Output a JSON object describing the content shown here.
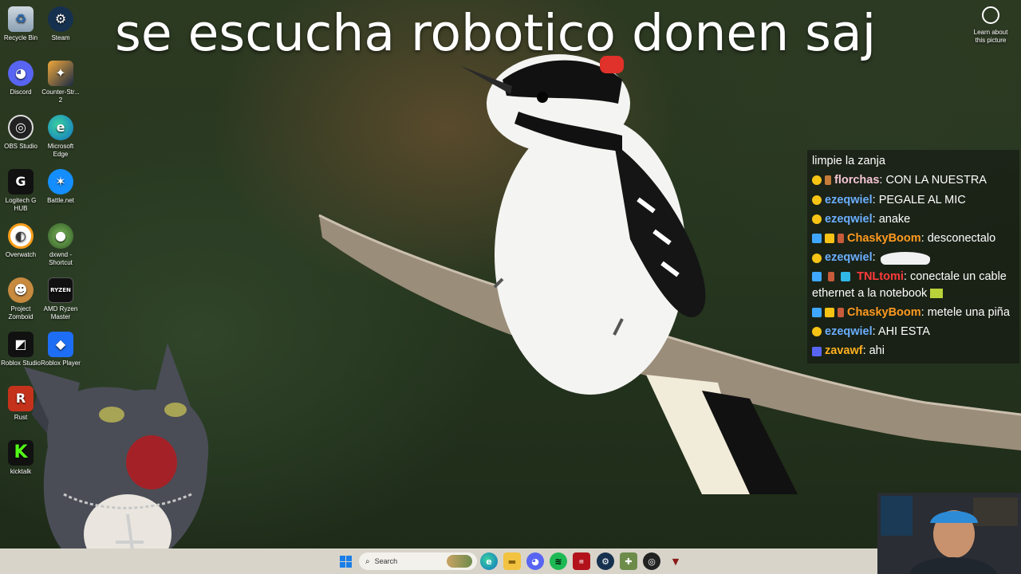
{
  "desktop": {
    "icons": [
      {
        "label": "Recycle Bin",
        "icon": "recycle-bin-icon"
      },
      {
        "label": "Steam",
        "icon": "steam-icon"
      },
      {
        "label": "Discord",
        "icon": "discord-icon"
      },
      {
        "label": "Counter-Str... 2",
        "icon": "counter-strike-icon"
      },
      {
        "label": "OBS Studio",
        "icon": "obs-icon"
      },
      {
        "label": "Microsoft Edge",
        "icon": "edge-icon"
      },
      {
        "label": "Logitech G HUB",
        "icon": "logitech-icon"
      },
      {
        "label": "Battle.net",
        "icon": "battlenet-icon"
      },
      {
        "label": "Overwatch",
        "icon": "overwatch-icon"
      },
      {
        "label": "dxwnd - Shortcut",
        "icon": "dxwnd-icon"
      },
      {
        "label": "Project Zomboid",
        "icon": "zomboid-icon"
      },
      {
        "label": "AMD Ryzen Master",
        "icon": "ryzen-icon"
      },
      {
        "label": "Roblox Studio",
        "icon": "roblox-studio-icon"
      },
      {
        "label": "Roblox Player",
        "icon": "roblox-player-icon"
      },
      {
        "label": "Rust",
        "icon": "rust-icon"
      },
      {
        "label": "kicktalk",
        "icon": "kicktalk-icon"
      }
    ]
  },
  "overlay": {
    "caption": "se escucha robotico donen saj"
  },
  "spotlight": {
    "label": "Learn about this picture"
  },
  "chat": {
    "messages": [
      {
        "user": "",
        "text": "limpie la zanja"
      },
      {
        "user": "florchas",
        "text": ": CON LA NUESTRA",
        "color": "#f5c6d6"
      },
      {
        "user": "ezeqwiel",
        "text": ": PEGALE AL MIC",
        "color": "#6aaeff"
      },
      {
        "user": "ezeqwiel",
        "text": ": anake",
        "color": "#6aaeff"
      },
      {
        "user": "ChaskyBoom",
        "text": ": desconectalo",
        "color": "#ff9a1f"
      },
      {
        "user": "ezeqwiel",
        "text": ":",
        "color": "#6aaeff"
      },
      {
        "user": "TNLtomi",
        "text": ": conectale un cable ethernet a la notebook",
        "color": "#ff3a3a"
      },
      {
        "user": "ChaskyBoom",
        "text": ": metele una piña",
        "color": "#ff9a1f"
      },
      {
        "user": "ezeqwiel",
        "text": ": AHI ESTA",
        "color": "#6aaeff"
      },
      {
        "user": "zavawf",
        "text": ": ahi",
        "color": "#ffb020"
      }
    ]
  },
  "taskbar": {
    "search_placeholder": "Search",
    "items": [
      "start-icon",
      "search",
      "edge-icon",
      "file-explorer-icon",
      "discord-icon",
      "spotify-icon",
      "app-icon",
      "steam-icon",
      "app-icon",
      "obs-icon",
      "app-icon"
    ]
  },
  "colors": {
    "taskbar_bg": "#d8d4ca",
    "chat_bg": "rgba(20,22,18,0.62)"
  }
}
